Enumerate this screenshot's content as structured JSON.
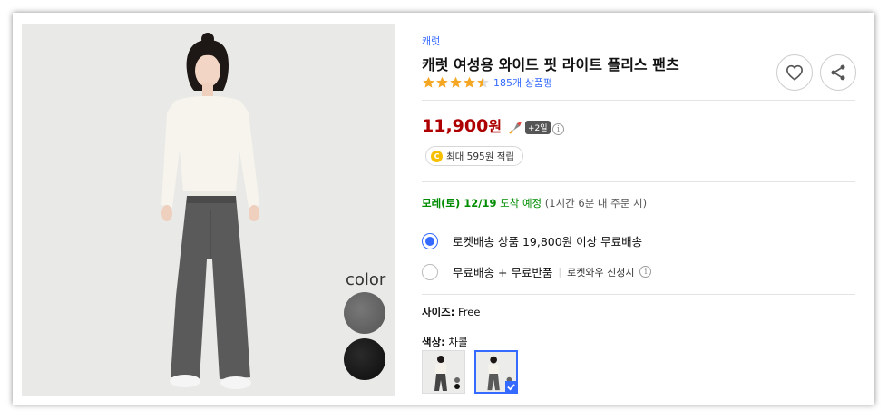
{
  "product": {
    "brand": "캐럿",
    "title": "캐럿 여성용 와이드 핏 라이트 플리스 팬츠",
    "rating_value": 4.5,
    "review_count": "185개 상품평",
    "price": "11,900",
    "price_unit": "원",
    "rocket_plus": "+2일",
    "cash_back": "최대 595원 적립",
    "cash_icon": "C"
  },
  "image": {
    "swatch_label": "color",
    "swatches": [
      "gray",
      "black"
    ]
  },
  "delivery": {
    "date": "모레(토) 12/19",
    "arrive": "도착 예정",
    "cutoff": "(1시간 6분 내 주문 시)"
  },
  "shipping_options": [
    {
      "label": "로켓배송 상품 19,800원 이상 무료배송",
      "selected": true
    },
    {
      "label": "무료배송 + 무료반품",
      "sub": "로켓와우 신청시",
      "selected": false
    }
  ],
  "size": {
    "label": "사이즈:",
    "value": "Free"
  },
  "color": {
    "label": "색상:",
    "value": "차콜"
  },
  "colors": {
    "accent": "#346aff",
    "price": "#ae0000",
    "delivery": "#008c00",
    "star": "#f5a623"
  }
}
